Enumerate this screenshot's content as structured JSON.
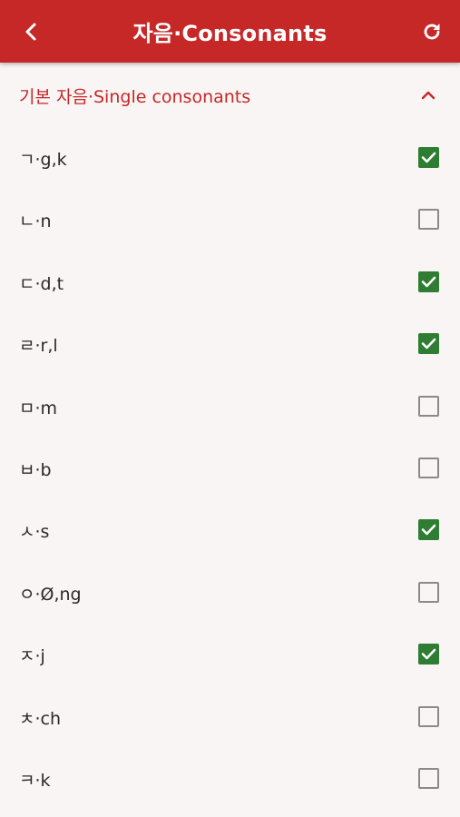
{
  "header": {
    "title": "자음·Consonants",
    "back_icon": "chevron-left-icon",
    "refresh_icon": "refresh-icon",
    "background": "#c62828"
  },
  "section": {
    "title": "기본 자음·Single consonants",
    "expanded": true,
    "accent": "#c62828"
  },
  "consonants": [
    {
      "label": "ㄱ·g,k",
      "checked": true
    },
    {
      "label": "ㄴ·n",
      "checked": false
    },
    {
      "label": "ㄷ·d,t",
      "checked": true
    },
    {
      "label": "ㄹ·r,l",
      "checked": true
    },
    {
      "label": "ㅁ·m",
      "checked": false
    },
    {
      "label": "ㅂ·b",
      "checked": false
    },
    {
      "label": "ㅅ·s",
      "checked": true
    },
    {
      "label": "ㅇ·Ø,ng",
      "checked": false
    },
    {
      "label": "ㅈ·j",
      "checked": true
    },
    {
      "label": "ㅊ·ch",
      "checked": false
    },
    {
      "label": "ㅋ·k",
      "checked": false
    }
  ],
  "colors": {
    "checked": "#2e7d32",
    "unchecked_border": "#8a8a8a",
    "background": "#f8f5f4"
  }
}
